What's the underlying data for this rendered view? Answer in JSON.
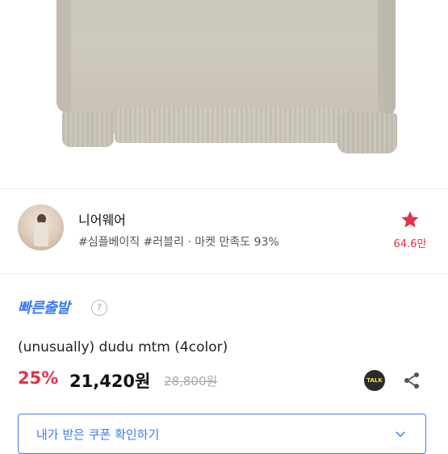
{
  "shop": {
    "name": "니어웨어",
    "tags": "#심플베이직 #러블리 · 마켓 만족도 93%",
    "like_count": "64.6만"
  },
  "delivery": {
    "badge": "빠른출발",
    "help": "?"
  },
  "product": {
    "title": "(unusually) dudu mtm (4color)",
    "discount": "25%",
    "price": "21,420원",
    "original_price": "28,800원"
  },
  "actions": {
    "talk_label": "TALK"
  },
  "coupon": {
    "label": "내가 받은 쿠폰 확인하기"
  },
  "colors": {
    "accent_red": "#e2324a",
    "accent_blue": "#3d7bf0"
  },
  "icons": [
    "star-icon",
    "help-icon",
    "talk-icon",
    "share-icon",
    "chevron-down-icon"
  ]
}
